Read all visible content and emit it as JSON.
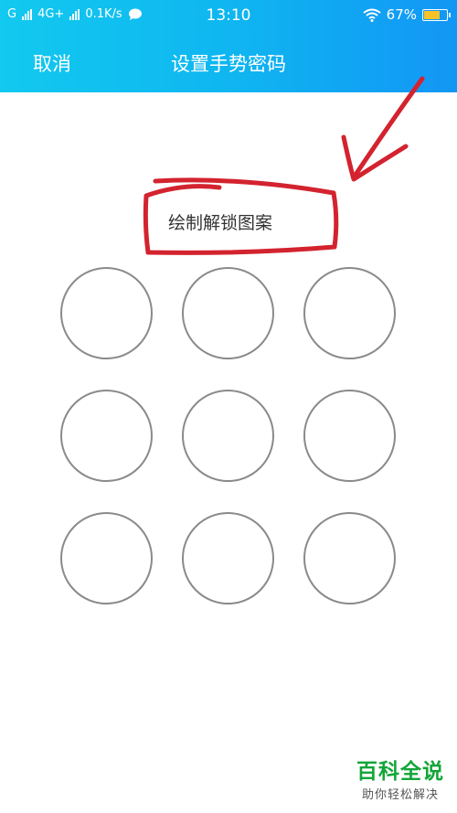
{
  "status_bar": {
    "carrier1": "G",
    "network": "4G+",
    "speed": "0.1K/s",
    "time": "13:10",
    "battery": "67%",
    "battery_level": 0.67,
    "battery_color": "#f5c22a"
  },
  "nav": {
    "cancel_label": "取消",
    "title": "设置手势密码"
  },
  "content": {
    "hint": "绘制解锁图案",
    "pattern_dots": 9
  },
  "watermark": {
    "title": "百科全说",
    "subtitle": "助你轻松解决"
  },
  "colors": {
    "header_gradient_start": "#12c9ef",
    "header_gradient_end": "#1296f5",
    "annotation_red": "#d3232f",
    "dot_border": "#8a8a8a",
    "watermark_green": "#13a538"
  }
}
